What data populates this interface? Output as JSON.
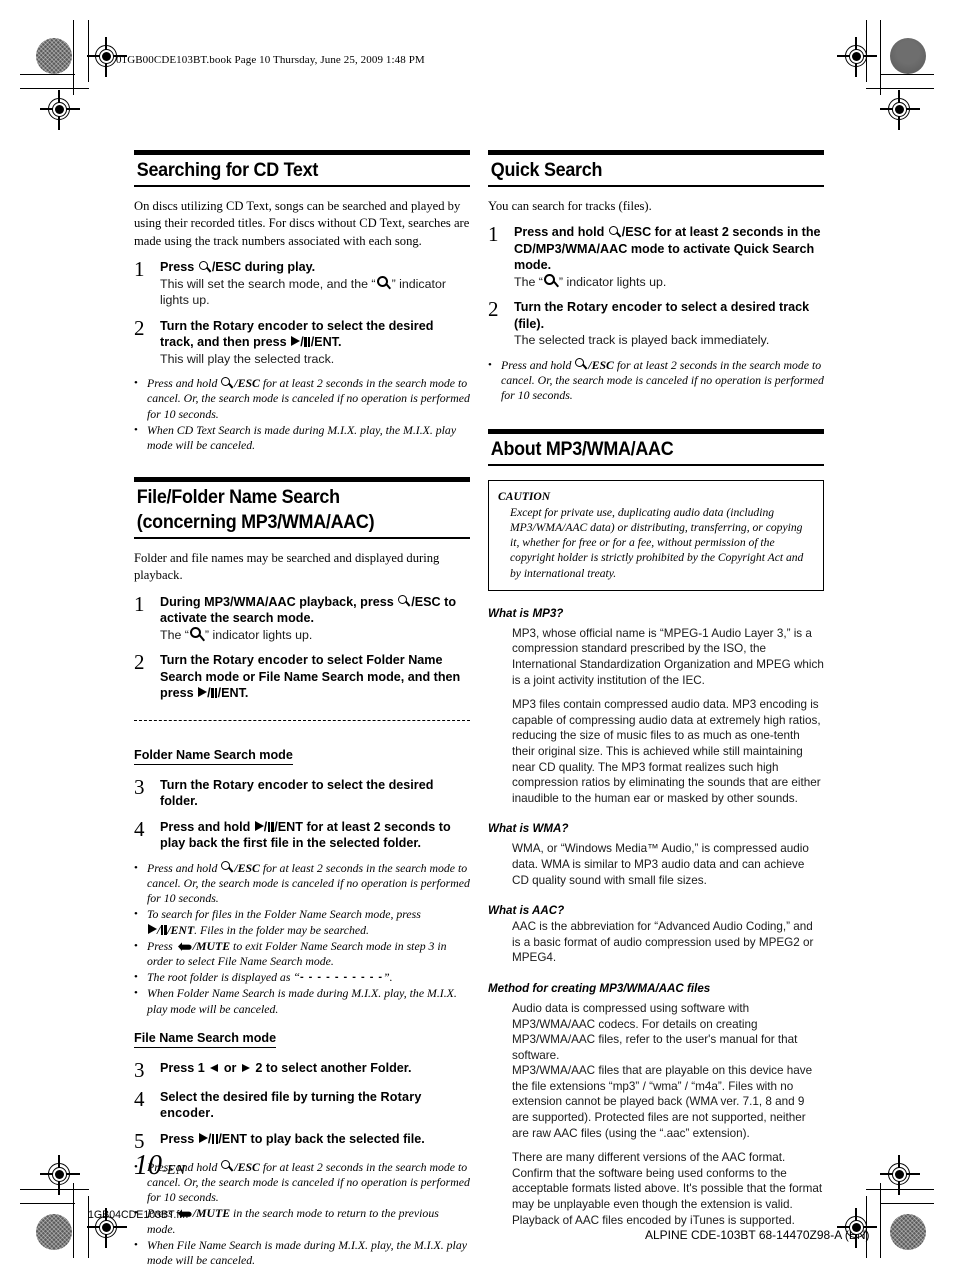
{
  "header": {
    "book_line": "01GB00CDE103BT.book  Page 10  Thursday, June 25, 2009  1:48 PM"
  },
  "footer": {
    "page_number": "10",
    "page_suffix": "-EN",
    "file_name": "1GB04CDE103BT.fm",
    "doc_code": "ALPINE CDE-103BT 68-14470Z98-A (EN)"
  },
  "left_column": {
    "section1": {
      "title": "Searching for CD Text",
      "intro": "On discs utilizing CD Text, songs can be searched and played by using their recorded titles. For discs without CD Text, searches are made using the track numbers associated with each song.",
      "steps": [
        {
          "num": "1",
          "main_a": "Press ",
          "main_b": "/ESC",
          "main_c": " during play.",
          "sub_a": "This will set the search mode, and the “",
          "sub_b": "” indicator lights up."
        },
        {
          "num": "2",
          "main_a": "Turn the ",
          "main_bold": "Rotary encoder",
          "main_b": " to select the desired track, and then press ",
          "main_c": "/",
          "main_d": "/ENT.",
          "sub": "This will play the selected track."
        }
      ],
      "notes": [
        {
          "a": "Press and hold ",
          "b": "/ESC",
          "c": " for at least 2 seconds in the search mode to cancel. Or, the search mode is canceled if no operation is performed for 10 seconds."
        },
        {
          "full": "When CD Text Search is made during M.I.X. play, the M.I.X. play mode will be canceled."
        }
      ]
    },
    "section2": {
      "title": "File/Folder Name Search\n(concerning MP3/WMA/AAC)",
      "intro": "Folder and file names may be searched and displayed during playback.",
      "steps": [
        {
          "num": "1",
          "main_a": "During MP3/WMA/AAC playback, press ",
          "main_b": "/ESC",
          "main_c": " to activate the search mode.",
          "sub_a": "The “",
          "sub_b": "” indicator lights up."
        },
        {
          "num": "2",
          "main_a": "Turn the ",
          "main_bold": "Rotary encoder",
          "main_b": " to select Folder Name Search mode or File Name Search mode, and then press ",
          "main_c": "/",
          "main_d": "/ENT."
        }
      ],
      "folder_mode": {
        "label": "Folder Name Search mode",
        "steps": [
          {
            "num": "3",
            "main_a": "Turn the ",
            "main_bold": "Rotary encoder",
            "main_b": " to select the desired folder."
          },
          {
            "num": "4",
            "main_a": "Press and hold ",
            "main_c": "/",
            "main_d": "/ENT",
            "main_e": " for at least 2 seconds to play back the first file in the selected folder."
          }
        ],
        "notes": [
          {
            "a": "Press and hold ",
            "b": "/ESC",
            "c": " for at least 2 seconds in the search mode to cancel. Or, the search mode is canceled if no operation is performed for 10 seconds."
          },
          {
            "a2": "To search for files in the Folder Name Search mode, press ",
            "b2": "/",
            "c2": "/ENT",
            "d2": ". Files in the folder may be searched."
          },
          {
            "a3": "Press ",
            "b3": "/MUTE",
            "c3": " to exit Folder Name Search mode in step 3 in order to select File Name Search mode."
          },
          {
            "a4": "The root folder is displayed as “",
            "dashes": "- - - - - - - - - -",
            "c4": "”."
          },
          {
            "full": "When Folder Name Search is made during M.I.X. play, the M.I.X. play mode will be canceled."
          }
        ]
      },
      "file_mode": {
        "label": "File Name Search mode",
        "steps": [
          {
            "num": "3",
            "main_a": "Press 1 ",
            "main_b": " or ",
            "main_c": " 2 to select another Folder."
          },
          {
            "num": "4",
            "main_a": "Select the desired file by turning the ",
            "main_bold": "Rotary encoder",
            "main_b": "."
          },
          {
            "num": "5",
            "main_a": "Press ",
            "main_c": "/",
            "main_d": "/ENT",
            "main_e": " to play back the selected file."
          }
        ],
        "notes": [
          {
            "a": "Press and hold ",
            "b": "/ESC",
            "c": " for at least 2 seconds in the search mode to cancel. Or, the search mode is canceled if no operation is performed for 10 seconds."
          },
          {
            "a3": "Press ",
            "b3": "/MUTE",
            "c3": " in the search mode to return to the previous mode."
          },
          {
            "full": "When File Name Search is made during M.I.X. play, the M.I.X. play mode will be canceled."
          }
        ]
      }
    }
  },
  "right_column": {
    "section1": {
      "title": "Quick Search",
      "intro": "You can search for tracks (files).",
      "steps": [
        {
          "num": "1",
          "main_a": "Press and hold ",
          "main_b": "/ESC",
          "main_c": " for at least 2 seconds in the CD/MP3/WMA/AAC mode to activate Quick Search mode.",
          "sub_a": "The “",
          "sub_b": "” indicator lights up."
        },
        {
          "num": "2",
          "main_a": "Turn the ",
          "main_bold": "Rotary encoder",
          "main_b": " to select a desired track (file).",
          "sub": "The selected track is played back immediately."
        }
      ],
      "notes": [
        {
          "a": "Press and hold ",
          "b": "/ESC",
          "c": " for at least 2 seconds in the search mode to cancel. Or, the search mode is canceled if no operation is performed for 10 seconds."
        }
      ]
    },
    "section2": {
      "title": "About MP3/WMA/AAC",
      "caution": {
        "title": "CAUTION",
        "text": "Except for private use, duplicating audio data (including MP3/WMA/AAC data) or distributing, transferring, or copying it, whether for free or for a fee, without permission of the copyright holder is strictly prohibited by the Copyright Act and by international treaty."
      },
      "faqs": [
        {
          "q": "What is MP3?",
          "paragraphs": [
            "MP3, whose official name is “MPEG-1 Audio Layer 3,” is a compression standard prescribed by the ISO, the International Standardization Organization and MPEG which is a joint activity institution of the IEC.",
            "MP3 files contain compressed audio data. MP3 encoding is capable of compressing audio data at extremely high ratios, reducing the size of music files to as much as one-tenth their original size. This is achieved while still maintaining near CD quality. The MP3 format realizes such high compression ratios by eliminating the sounds that are either inaudible to the human ear or masked by other sounds."
          ]
        },
        {
          "q": "What is WMA?",
          "paragraphs": [
            "WMA, or “Windows Media™ Audio,” is compressed audio data. WMA is similar to MP3 audio data and can achieve CD quality sound with small file sizes."
          ]
        },
        {
          "q": "What is AAC?",
          "paragraphs": [
            "AAC is the abbreviation for “Advanced Audio Coding,” and is a basic format of audio compression used by MPEG2 or MPEG4."
          ]
        },
        {
          "q": "Method for creating MP3/WMA/AAC files",
          "paragraphs": [
            "Audio data is compressed using software with MP3/WMA/AAC codecs. For details on creating MP3/WMA/AAC files, refer to the user's manual for that software.\nMP3/WMA/AAC files that are playable on this device have the file extensions “mp3” / “wma” / “m4a”. Files with no extension cannot be played back (WMA ver. 7.1, 8 and 9 are supported). Protected files are not supported, neither are raw AAC files (using the “.aac” extension).",
            "There are many different versions of the AAC format. Confirm that the software being used conforms to the acceptable formats listed above. It's possible that the format may be unplayable even though the extension is valid.\nPlayback of AAC files encoded by iTunes is supported."
          ]
        }
      ]
    }
  },
  "icons": {
    "search": "search-icon",
    "play": "play-icon",
    "pause": "pause-icon",
    "prev": "left-arrow-icon",
    "next": "right-arrow-icon",
    "mute": "return-mute-icon"
  },
  "colors": {
    "ink": "#000000",
    "paper": "#ffffff"
  }
}
